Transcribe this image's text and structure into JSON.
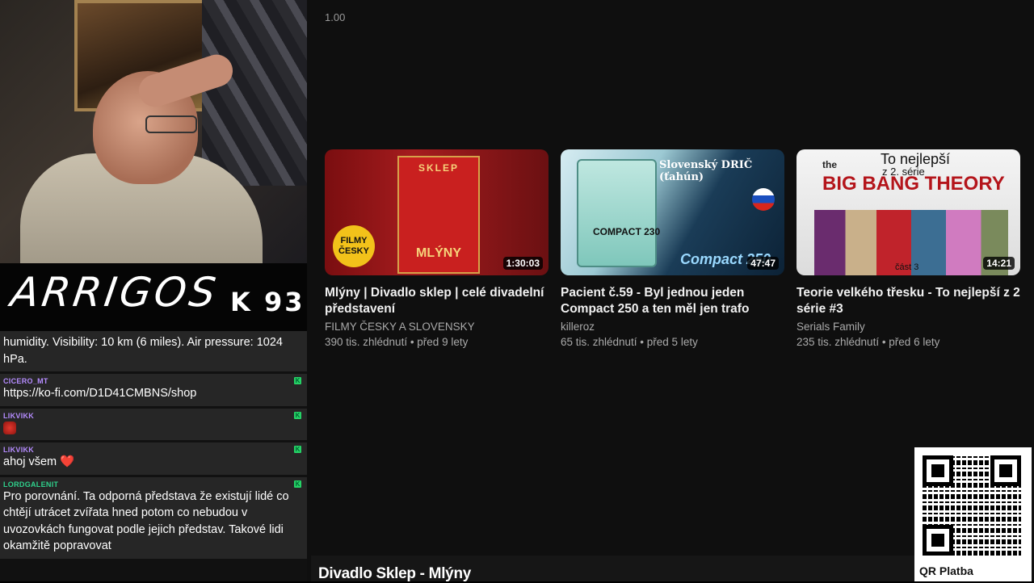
{
  "stream": {
    "logo_text": "ARRIGOS",
    "logo_number": "K 93"
  },
  "chat": [
    {
      "user": "",
      "user_color": "#ffffff",
      "text": "humidity. Visibility: 10 km (6 miles). Air pressure: 1024 hPa.",
      "badge": false
    },
    {
      "user": "CICERO_MT",
      "user_color": "#b58cff",
      "text": "https://ko-fi.com/D1D41CMBNS/shop",
      "badge": true
    },
    {
      "user": "LIKVIKK",
      "user_color": "#b58cff",
      "text": "",
      "emote": "red-emote",
      "badge": true
    },
    {
      "user": "LIKVIKK",
      "user_color": "#b58cff",
      "text": "ahoj všem",
      "heart": "❤️",
      "badge": true
    },
    {
      "user": "LORDGALENIT",
      "user_color": "#2fd18c",
      "text": "Pro porovnání. Ta odporná představa že existují lidé co chtějí utrácet zvířata hned potom co nebudou v uvozovkách fungovat podle jejich představ. Takové lidi okamžitě popravovat",
      "badge": true
    }
  ],
  "player": {
    "speed": "1.00",
    "now_playing": "Divadlo Sklep - Mlýny"
  },
  "videos": [
    {
      "title": "Mlýny | Divadlo sklep | celé divadelní představení",
      "channel": "FILMY ČESKY A SLOVENSKY",
      "meta": "390 tis. zhlédnutí • před 9 lety",
      "duration": "1:30:03",
      "thumb_text_top": "SKLEP",
      "thumb_text_bottom": "MLÝNY",
      "thumb_badge": "FILMY ČESKY"
    },
    {
      "title": "Pacient č.59 - Byl jednou jeden Compact 250 a ten měl jen trafo",
      "channel": "killeroz",
      "meta": "65 tis. zhlédnutí • před 5 lety",
      "duration": "47:47",
      "thumb_text_top": "Slovenský DRIČ (ťahún)",
      "thumb_text_machine": "COMPACT 230",
      "thumb_text_bottom": "Compact 250"
    },
    {
      "title": "Teorie velkého třesku - To nejlepší z 2 série #3",
      "channel": "Serials Family",
      "meta": "235 tis. zhlédnutí • před 6 lety",
      "duration": "14:21",
      "thumb_text_show_small": "the",
      "thumb_text_show": "BIG BANG THEORY",
      "thumb_text_top": "To nejlepší",
      "thumb_text_sub": "z 2. série",
      "thumb_text_part": "část 3"
    }
  ],
  "qr": {
    "label": "QR Platba"
  }
}
